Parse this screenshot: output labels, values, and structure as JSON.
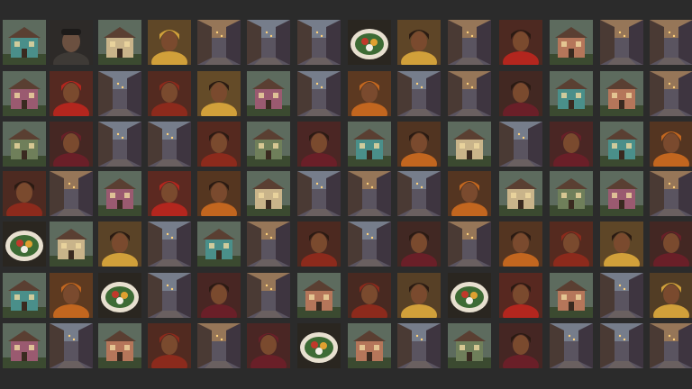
{
  "gallery": {
    "rows": [
      [
        "house",
        "elder",
        "house",
        "portrait",
        "street",
        "street",
        "street",
        "food",
        "portrait",
        "street",
        "portrait",
        "house",
        "street",
        "street"
      ],
      [
        "house",
        "portrait",
        "street",
        "portrait",
        "portrait",
        "house",
        "street",
        "portrait",
        "street",
        "street",
        "portrait",
        "house",
        "house",
        "street"
      ],
      [
        "house",
        "portrait",
        "street",
        "street",
        "portrait",
        "house",
        "portrait",
        "house",
        "portrait",
        "house",
        "street",
        "portrait",
        "house",
        "portrait"
      ],
      [
        "portrait",
        "street",
        "house",
        "portrait",
        "portrait",
        "house",
        "street",
        "street",
        "street",
        "portrait",
        "house",
        "house",
        "house",
        "street"
      ],
      [
        "food",
        "house",
        "portrait",
        "street",
        "house",
        "street",
        "portrait",
        "street",
        "portrait",
        "street",
        "portrait",
        "portrait",
        "portrait",
        "portrait"
      ],
      [
        "house",
        "portrait",
        "food",
        "street",
        "portrait",
        "street",
        "house",
        "portrait",
        "portrait",
        "food",
        "portrait",
        "house",
        "street",
        "portrait"
      ],
      [
        "house",
        "street",
        "house",
        "portrait",
        "street",
        "portrait",
        "food",
        "house",
        "street",
        "house",
        "portrait",
        "street",
        "street",
        "street"
      ]
    ],
    "palette": {
      "background": "#2b2b2b",
      "skin": "#7a4a2e",
      "wrap_red": "#b3261e",
      "wrap_orange": "#c2661f",
      "house_teal": "#4a8f8a",
      "street_dusk": "#5a5460",
      "food_green": "#3d6b35"
    }
  }
}
